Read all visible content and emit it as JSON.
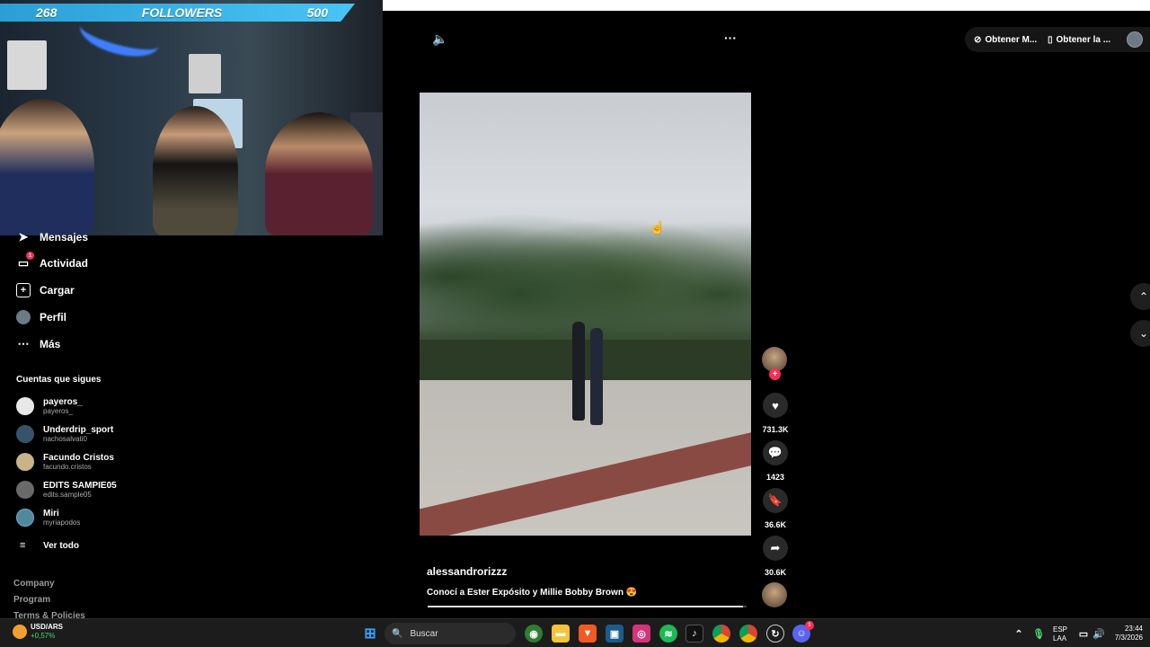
{
  "overlay": {
    "followers_current": "268",
    "followers_label": "FOLLOWERS",
    "followers_goal": "500"
  },
  "sidebar": {
    "items": [
      {
        "label": "Mensajes",
        "icon": "paper-plane-icon"
      },
      {
        "label": "Actividad",
        "icon": "message-icon",
        "badge": "1"
      },
      {
        "label": "Cargar",
        "icon": "plus-square-icon"
      },
      {
        "label": "Perfil",
        "icon": "avatar-icon"
      },
      {
        "label": "Más",
        "icon": "more-dots-icon"
      }
    ],
    "following_title": "Cuentas que sigues",
    "accounts": [
      {
        "name": "payeros_",
        "handle": "payeros_",
        "color": "#e8e8e8"
      },
      {
        "name": "Underdrip_sport",
        "handle": "nachosalvati0",
        "color": "#35546b"
      },
      {
        "name": "Facundo Cristos",
        "handle": "facundo.cristos",
        "color": "#c9b48a"
      },
      {
        "name": "EDITS SAMPIE05",
        "handle": "edits.sample05",
        "color": "#6a6a6a"
      },
      {
        "name": "Miri",
        "handle": "myriapodos",
        "color": "#4f8a98"
      }
    ],
    "see_all": "Ver todo",
    "footer": [
      "Company",
      "Program",
      "Terms & Policies"
    ]
  },
  "header": {
    "pill1": "Obtener M...",
    "pill2": "Obtener la ..."
  },
  "video": {
    "author": "alessandrorizzz",
    "caption": "Conocí a Ester Expósito y Millie Bobby Brown 😍",
    "likes": "731.3K",
    "comments": "1423",
    "saves": "36.6K",
    "shares": "30.6K",
    "progress_fraction": 0.99
  },
  "taskbar": {
    "ticker_name": "USD/ARS",
    "ticker_change": "+0,57%",
    "search_label": "Buscar",
    "lang1": "ESP",
    "lang2": "LAA",
    "time": "23:44",
    "date": "7/3/2026",
    "discord_badge": "1"
  },
  "colors": {
    "accent": "#fe2c55",
    "bar": "#49c4f5"
  }
}
